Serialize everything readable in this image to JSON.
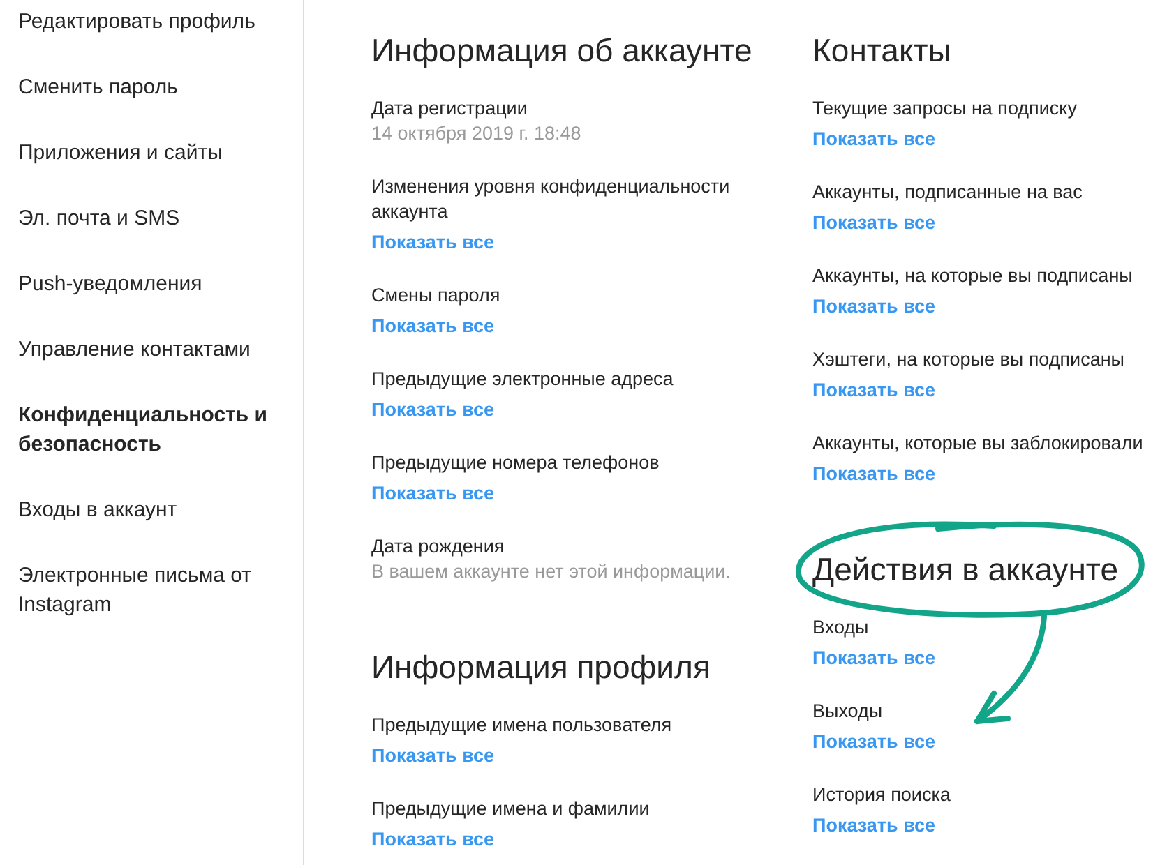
{
  "sidebar": {
    "items": [
      {
        "label": "Редактировать профиль",
        "selected": false
      },
      {
        "label": "Сменить пароль",
        "selected": false
      },
      {
        "label": "Приложения и сайты",
        "selected": false
      },
      {
        "label": "Эл. почта и SMS",
        "selected": false
      },
      {
        "label": "Push-уведомления",
        "selected": false
      },
      {
        "label": "Управление контактами",
        "selected": false
      },
      {
        "label": "Конфиденциальность и безопасность",
        "selected": true
      },
      {
        "label": "Входы в аккаунт",
        "selected": false
      },
      {
        "label": "Электронные письма от Instagram",
        "selected": false
      }
    ]
  },
  "columns": [
    {
      "sections": [
        {
          "title": "Информация об аккаунте",
          "annotated": false,
          "items": [
            {
              "label": "Дата регистрации",
              "value": "14 октября 2019 г. 18:48"
            },
            {
              "label": "Изменения уровня конфиденциальности аккаунта",
              "link": "Показать все"
            },
            {
              "label": "Смены пароля",
              "link": "Показать все"
            },
            {
              "label": "Предыдущие электронные адреса",
              "link": "Показать все"
            },
            {
              "label": "Предыдущие номера телефонов",
              "link": "Показать все"
            },
            {
              "label": "Дата рождения",
              "value": "В вашем аккаунте нет этой информации."
            }
          ]
        },
        {
          "title": "Информация профиля",
          "annotated": false,
          "items": [
            {
              "label": "Предыдущие имена пользователя",
              "link": "Показать все"
            },
            {
              "label": "Предыдущие имена и фамилии",
              "link": "Показать все"
            }
          ]
        }
      ]
    },
    {
      "sections": [
        {
          "title": "Контакты",
          "annotated": false,
          "items": [
            {
              "label": "Текущие запросы на подписку",
              "link": "Показать все"
            },
            {
              "label": "Аккаунты, подписанные на вас",
              "link": "Показать все"
            },
            {
              "label": "Аккаунты, на которые вы подписаны",
              "link": "Показать все"
            },
            {
              "label": "Хэштеги, на которые вы подписаны",
              "link": "Показать все"
            },
            {
              "label": "Аккаунты, которые вы заблокировали",
              "link": "Показать все"
            }
          ]
        },
        {
          "title": "Действия в аккаунте",
          "annotated": true,
          "items": [
            {
              "label": "Входы",
              "link": "Показать все"
            },
            {
              "label": "Выходы",
              "link": "Показать все"
            },
            {
              "label": "История поиска",
              "link": "Показать все"
            }
          ]
        }
      ]
    }
  ]
}
